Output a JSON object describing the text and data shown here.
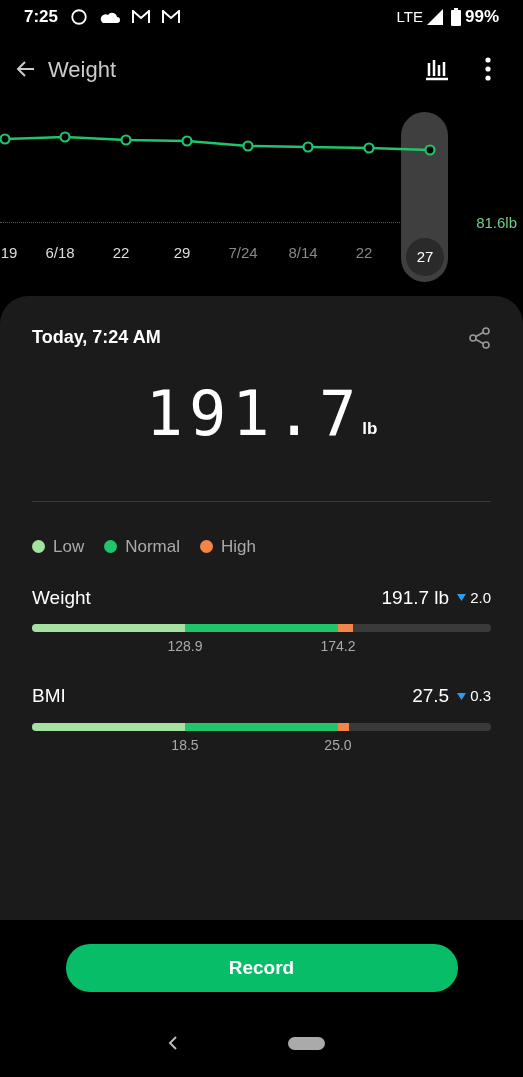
{
  "status_bar": {
    "time": "7:25",
    "network": "LTE",
    "battery": "99%"
  },
  "header": {
    "title": "Weight"
  },
  "chart": {
    "reference_label": "81.6lb",
    "x_labels": [
      {
        "label": "19",
        "selected": false,
        "dim": false
      },
      {
        "label": "6/18",
        "selected": false,
        "dim": false
      },
      {
        "label": "22",
        "selected": false,
        "dim": false
      },
      {
        "label": "29",
        "selected": false,
        "dim": false
      },
      {
        "label": "7/24",
        "selected": false,
        "dim": true
      },
      {
        "label": "8/14",
        "selected": false,
        "dim": true
      },
      {
        "label": "22",
        "selected": false,
        "dim": true
      },
      {
        "label": "27",
        "selected": true,
        "dim": false
      }
    ]
  },
  "card": {
    "timestamp": "Today, 7:24 AM",
    "value": "191.7",
    "unit": "lb",
    "legend": [
      {
        "label": "Low",
        "color": "#a5e1a1"
      },
      {
        "label": "Normal",
        "color": "#1fc46b"
      },
      {
        "label": "High",
        "color": "#f4854a"
      }
    ],
    "metrics": [
      {
        "name": "Weight",
        "value": "191.7 lb",
        "change": "2.0",
        "level": 0.7,
        "ticks": [
          "128.9",
          "174.2"
        ]
      },
      {
        "name": "BMI",
        "value": "27.5",
        "change": "0.3",
        "level": 0.69,
        "ticks": [
          "18.5",
          "25.0"
        ]
      }
    ]
  },
  "record_button": "Record"
}
